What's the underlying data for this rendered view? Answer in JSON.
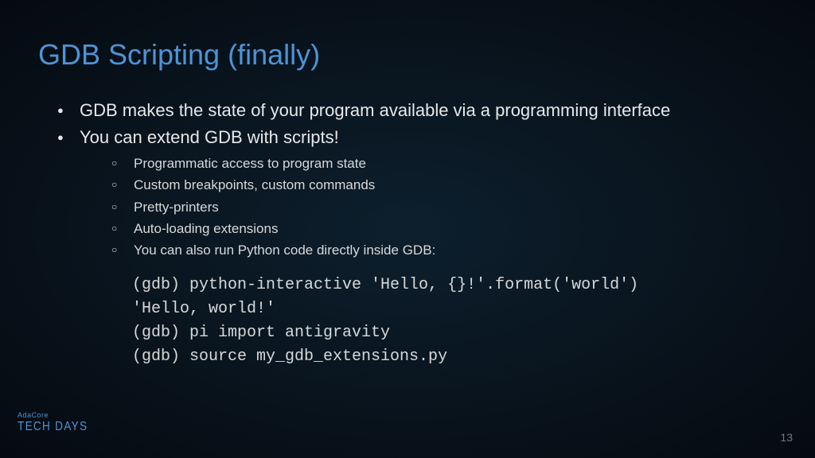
{
  "title": "GDB Scripting (finally)",
  "bullets": {
    "b1": "GDB makes the state of your program available via a programming interface",
    "b2": "You can extend GDB with scripts!",
    "sub": {
      "s1": "Programmatic access to program state",
      "s2": "Custom breakpoints, custom commands",
      "s3": "Pretty-printers",
      "s4": "Auto-loading extensions",
      "s5": "You can also run Python code directly inside GDB:"
    }
  },
  "code": "(gdb) python-interactive 'Hello, {}!'.format('world')\n'Hello, world!'\n(gdb) pi import antigravity\n(gdb) source my_gdb_extensions.py",
  "logo": {
    "top": "AdaCore",
    "bottom": "TECH DAYS"
  },
  "page_number": "13"
}
